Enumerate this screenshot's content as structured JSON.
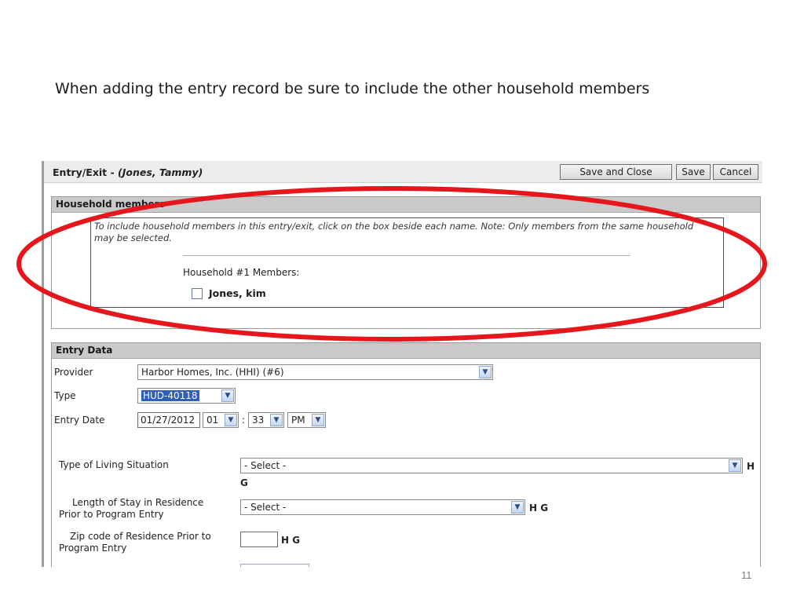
{
  "slide": {
    "caption": "When adding the entry record be sure to include the other household members",
    "page_number": "11"
  },
  "window": {
    "title_prefix": "Entry/Exit - ",
    "title_client": "(Jones, Tammy)",
    "buttons": {
      "save_close": "Save and Close",
      "save": "Save",
      "cancel": "Cancel"
    }
  },
  "household": {
    "heading": "Household members",
    "note": "To include household members in this entry/exit, click on the box beside each name. Note: Only members from the same household may be selected.",
    "group_label": "Household #1 Members:",
    "members": [
      {
        "name": "Jones, kim",
        "checked": false
      }
    ]
  },
  "entry_data": {
    "heading": "Entry Data",
    "provider": {
      "label": "Provider",
      "value": "Harbor Homes, Inc. (HHI) (#6)"
    },
    "type": {
      "label": "Type",
      "value": "HUD-40118"
    },
    "entry_date": {
      "label": "Entry Date",
      "date": "01/27/2012",
      "hour": "01",
      "separator": ":",
      "minute": "33",
      "ampm": "PM"
    },
    "living_situation": {
      "label": "Type of Living Situation",
      "value": "- Select -",
      "flag_h": "H",
      "flag_g": "G"
    },
    "length_of_stay": {
      "label": "Length of Stay in Residence Prior to Program Entry",
      "value": "- Select -",
      "flags": "H G"
    },
    "zip_code": {
      "label": "Zip code of Residence Prior to Program Entry",
      "value": "",
      "flags": "H G"
    }
  },
  "colors": {
    "annotation": "#e5171d",
    "panel_header": "#c9c9c9",
    "selection": "#2f5fb6"
  }
}
